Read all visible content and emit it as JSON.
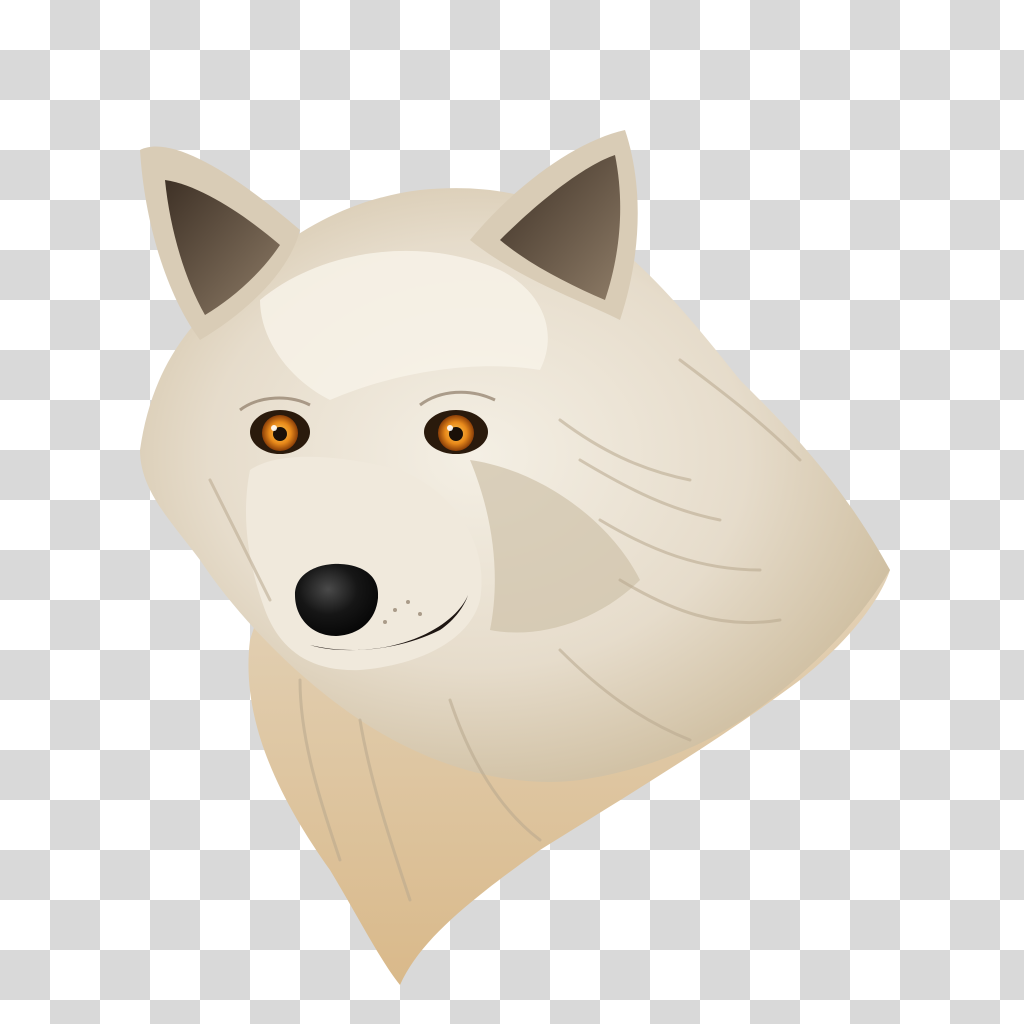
{
  "image": {
    "subject": "wolf-head-illustration",
    "background": "transparency-checkerboard",
    "colors": {
      "checker_light": "#ffffff",
      "checker_dark": "#d9d9d9",
      "fur_light": "#f1ebdf",
      "fur_mid": "#ddd2bf",
      "fur_shadow": "#b8a88e",
      "fur_warm": "#d9b98a",
      "ear_inner": "#6b5a48",
      "eye_iris": "#e8891a",
      "eye_pupil": "#1a1008",
      "nose": "#141414"
    }
  }
}
